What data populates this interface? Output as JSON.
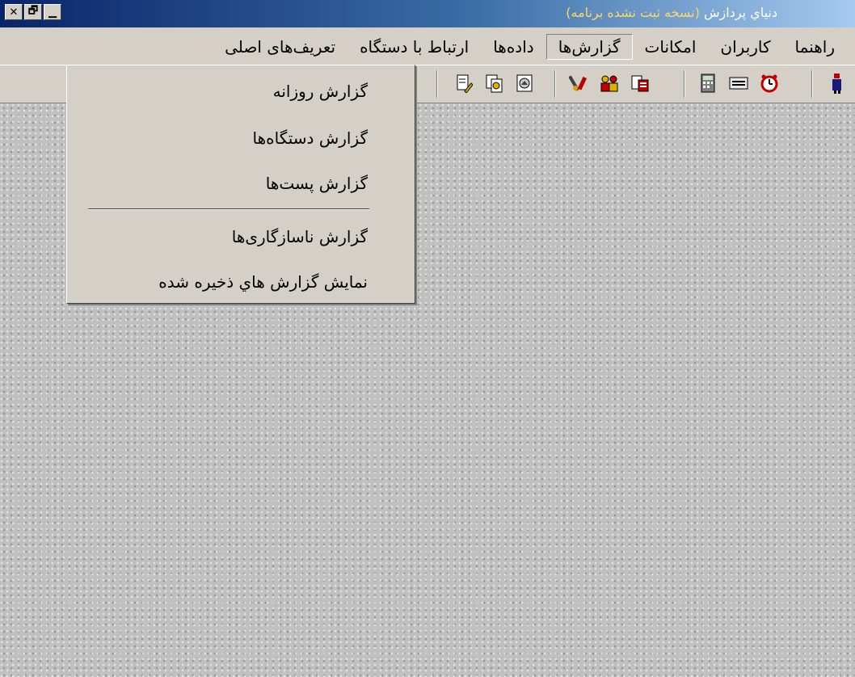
{
  "window": {
    "title": "دنياي پردازش",
    "title_note": "(نسخه ثبت نشده برنامه)",
    "controls": [
      "✕",
      "🗗",
      "▁"
    ]
  },
  "menu": {
    "items": [
      {
        "label": "تعريف‌هاى اصلى"
      },
      {
        "label": "ارتباط با دستگاه"
      },
      {
        "label": "داده‌ها"
      },
      {
        "label": "گزارش‌ها"
      },
      {
        "label": "امكانات"
      },
      {
        "label": "كاربران"
      },
      {
        "label": "راهنما"
      }
    ],
    "active_index": 3
  },
  "toolbar": {
    "icons": [
      "exit-icon",
      "alarm-clock-icon",
      "message-icon",
      "calculator-icon",
      "card-icon",
      "people-icon",
      "tools-icon",
      "report-image-icon",
      "report-copy-icon",
      "report-edit-icon"
    ]
  },
  "dropdown": {
    "items": [
      "گزارش روزانه",
      "گزارش دستگاه‌ها",
      "گزارش پست‌ها",
      "گزارش ناسازگارى‌ها",
      "نمايش گزارش هاي ذخيره شده"
    ]
  }
}
